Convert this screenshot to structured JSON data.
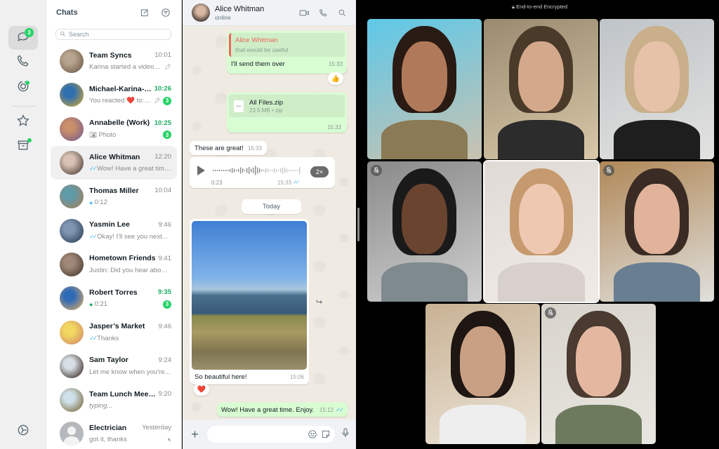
{
  "rail": {
    "items": [
      {
        "name": "chats",
        "icon": "chat-bubbles-icon",
        "badge": "3",
        "active": true
      },
      {
        "name": "calls",
        "icon": "phone-icon"
      },
      {
        "name": "status",
        "icon": "status-ring-icon",
        "dot": true
      },
      {
        "name": "starred",
        "icon": "star-icon"
      },
      {
        "name": "archived",
        "icon": "archive-icon",
        "dot": true
      }
    ],
    "settings_icon": "settings-icon"
  },
  "chatlist": {
    "title": "Chats",
    "new_chat_icon": "compose-icon",
    "filter_icon": "filter-icon",
    "search_placeholder": "Search",
    "chats": [
      {
        "name": "Team Syncs",
        "time": "10:01",
        "preview": "Karina started a video...",
        "pinned": true,
        "avatar_colors": [
          "#b8a58f",
          "#6e5a48"
        ]
      },
      {
        "name": "Michael-Karina-R...",
        "time": "10:26",
        "time_unread": true,
        "preview": "You reacted ❤️ to: “...",
        "pinned": true,
        "badge": "3",
        "avatar_colors": [
          "#2f6fb0",
          "#c9a23a"
        ]
      },
      {
        "name": "Annabelle (Work)",
        "time": "10:25",
        "time_unread": true,
        "preview": "Photo",
        "preview_icon": "camera-icon",
        "badge": "3",
        "avatar_colors": [
          "#c98f6a",
          "#7a5c8a"
        ]
      },
      {
        "name": "Alice Whitman",
        "time": "12:20",
        "preview": "Wow! Have a great time...",
        "read_ticks": true,
        "selected": true,
        "avatar_colors": [
          "#d9c2b5",
          "#4f3f35"
        ]
      },
      {
        "name": "Thomas Miller",
        "time": "10:04",
        "preview": "0:12",
        "preview_icon": "mic-blue-icon",
        "avatar_colors": [
          "#5f9aa8",
          "#a5805e"
        ]
      },
      {
        "name": "Yasmin Lee",
        "time": "9:46",
        "preview": "Okay! I'll see you next...",
        "read_ticks": true,
        "avatar_colors": [
          "#7f96b2",
          "#2e3e55"
        ]
      },
      {
        "name": "Hometown Friends",
        "time": "9:41",
        "preview": "Justin: Did you hear about...",
        "avatar_colors": [
          "#9f8877",
          "#4a3b32"
        ]
      },
      {
        "name": "Robert Torres",
        "time": "9:35",
        "time_unread": true,
        "preview": "0:21",
        "preview_icon": "mic-green-icon",
        "badge": "3",
        "avatar_colors": [
          "#2f6ab7",
          "#d3a86b"
        ]
      },
      {
        "name": "Jasper’s Market",
        "time": "9:46",
        "preview": "Thanks",
        "read_ticks": true,
        "avatar_colors": [
          "#f1d860",
          "#d48a6a"
        ]
      },
      {
        "name": "Sam Taylor",
        "time": "9:24",
        "preview": "Let me know when you're...",
        "avatar_colors": [
          "#d8e0e6",
          "#3a2a22"
        ]
      },
      {
        "name": "Team Lunch Meetu...",
        "time": "9:20",
        "preview": "typing...",
        "typing": true,
        "avatar_colors": [
          "#cfe0ea",
          "#7a6a3a"
        ]
      },
      {
        "name": "Electrician",
        "time": "Yesterday",
        "preview": "got it, thanks",
        "muted": true,
        "default_avatar": true,
        "avatar_colors": [
          "#b5b9bd",
          "#f3f3f3"
        ]
      }
    ]
  },
  "chat": {
    "contact_name": "Alice Whitman",
    "contact_status": "online",
    "header_icons": [
      "video-call-icon",
      "voice-call-icon",
      "search-icon"
    ],
    "messages": {
      "reply_quote_name": "Alice Whitman",
      "reply_quote_text": "that would be useful",
      "reply_text": "I'll send them over",
      "reply_time": "15:33",
      "reply_reaction": "👍",
      "file_name": "All Files.zip",
      "file_meta": "23.5 MB • zip",
      "file_type_label": "ZIP",
      "file_time": "15:33",
      "incoming_text": "These are great!",
      "incoming_time": "15:33",
      "voice_duration": "0:23",
      "voice_time": "15:33",
      "voice_speed": "2×",
      "date_divider": "Today",
      "photo_caption": "So beautiful here!",
      "photo_time": "15:06",
      "photo_reaction": "❤️",
      "last_out_text": "Wow! Have a great time. Enjoy.",
      "last_out_time": "15:12"
    },
    "composer": {
      "value": "",
      "attach_icon": "plus-icon",
      "emoji_icon": "emoji-icon",
      "sticker_icon": "sticker-icon",
      "mic_icon": "mic-icon"
    }
  },
  "call": {
    "encryption_label": "End-to-end Encrypted",
    "participants": [
      {
        "id": "p1",
        "muted": false,
        "bg": [
          "#5ec8e8",
          "#c9c2b0"
        ],
        "skin": "#b07a5a",
        "hair": "#2a1a14",
        "shirt": "#8a7a55"
      },
      {
        "id": "p2",
        "muted": false,
        "bg": [
          "#9a8a70",
          "#d8c8a8"
        ],
        "skin": "#d4a88a",
        "hair": "#4a3a2a",
        "shirt": "#2c2c2c"
      },
      {
        "id": "p3",
        "muted": false,
        "bg": [
          "#bfc4c8",
          "#e2e2e0"
        ],
        "skin": "#e6c2a8",
        "hair": "#c9b08a",
        "shirt": "#1e1e1e"
      },
      {
        "id": "p4",
        "muted": true,
        "bg": [
          "#8a8a8a",
          "#cfcfcf"
        ],
        "skin": "#6b4430",
        "hair": "#1a1a1a",
        "shirt": "#7e8a8e"
      },
      {
        "id": "p5",
        "muted": false,
        "speaking": true,
        "bg": [
          "#e0dad6",
          "#f0ebe6"
        ],
        "skin": "#efc8b2",
        "hair": "#c69a6e",
        "shirt": "#d8d0cc"
      },
      {
        "id": "p6",
        "muted": true,
        "bg": [
          "#b08858",
          "#e0e0dc"
        ],
        "skin": "#e0b39a",
        "hair": "#3a2c24",
        "shirt": "#6a7e92"
      },
      {
        "id": "p7",
        "muted": false,
        "bg": [
          "#c8b294",
          "#ece4d8"
        ],
        "skin": "#caa084",
        "hair": "#1e1612",
        "shirt": "#eeeeee"
      },
      {
        "id": "p8",
        "muted": true,
        "bg": [
          "#d8d4cc",
          "#e8e6e0"
        ],
        "skin": "#e4b8a0",
        "hair": "#4a3a30",
        "shirt": "#6e7a5e"
      }
    ]
  }
}
